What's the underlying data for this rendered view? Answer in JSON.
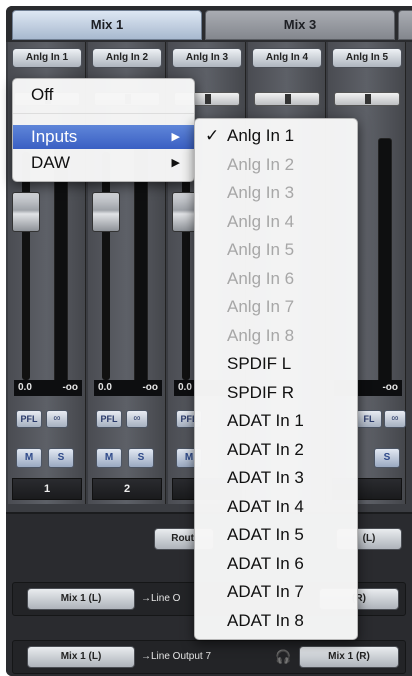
{
  "tabs": {
    "active": "Mix 1",
    "inactive": "Mix 3"
  },
  "strips": [
    {
      "source": "Anlg In 1",
      "channel": "1",
      "readout_left": "0.0",
      "readout_right": "-oo",
      "pfl": "PFL",
      "link": "∞",
      "mute": "M",
      "solo": "S"
    },
    {
      "source": "Anlg In 2",
      "channel": "2",
      "readout_left": "0.0",
      "readout_right": "-oo",
      "pfl": "PFL",
      "link": "∞",
      "mute": "M",
      "solo": "S"
    },
    {
      "source": "Anlg In 3",
      "channel": "",
      "readout_left": "0.0",
      "readout_right": "",
      "pfl": "PFL",
      "link": "∞",
      "mute": "M",
      "solo": "S"
    },
    {
      "source": "Anlg In 4",
      "channel": "",
      "readout_left": "",
      "readout_right": "",
      "pfl": "",
      "link": "",
      "mute": "",
      "solo": ""
    },
    {
      "source": "Anlg In 5",
      "channel": "",
      "readout_left": "",
      "readout_right": "-oo",
      "pfl": "FL",
      "link": "∞",
      "mute": "",
      "solo": "S"
    }
  ],
  "routing": {
    "routing_btn": "Routi",
    "routing_right": "(L)",
    "row1_left": "Mix 1 (L)",
    "row1_label": "→Line O",
    "row1_right": "(R)",
    "row2_left": "Mix 1 (L)",
    "row2_label": "→Line Output 7",
    "row2_right": "Mix 1 (R)"
  },
  "menu": {
    "items": [
      "Off",
      "Inputs",
      "DAW"
    ],
    "selected": "Inputs",
    "submenu_arrow": "▶"
  },
  "submenu": {
    "checked_item": "Anlg In 1",
    "check": "✓",
    "items": [
      {
        "label": "Anlg In 1",
        "enabled": true
      },
      {
        "label": "Anlg In 2",
        "enabled": false
      },
      {
        "label": "Anlg In 3",
        "enabled": false
      },
      {
        "label": "Anlg In 4",
        "enabled": false
      },
      {
        "label": "Anlg In 5",
        "enabled": false
      },
      {
        "label": "Anlg In 6",
        "enabled": false
      },
      {
        "label": "Anlg In 7",
        "enabled": false
      },
      {
        "label": "Anlg In 8",
        "enabled": false
      },
      {
        "label": "SPDIF L",
        "enabled": true
      },
      {
        "label": "SPDIF R",
        "enabled": true
      },
      {
        "label": "ADAT In 1",
        "enabled": true
      },
      {
        "label": "ADAT In 2",
        "enabled": true
      },
      {
        "label": "ADAT In 3",
        "enabled": true
      },
      {
        "label": "ADAT In 4",
        "enabled": true
      },
      {
        "label": "ADAT In 5",
        "enabled": true
      },
      {
        "label": "ADAT In 6",
        "enabled": true
      },
      {
        "label": "ADAT In 7",
        "enabled": true
      },
      {
        "label": "ADAT In 8",
        "enabled": true
      }
    ]
  }
}
